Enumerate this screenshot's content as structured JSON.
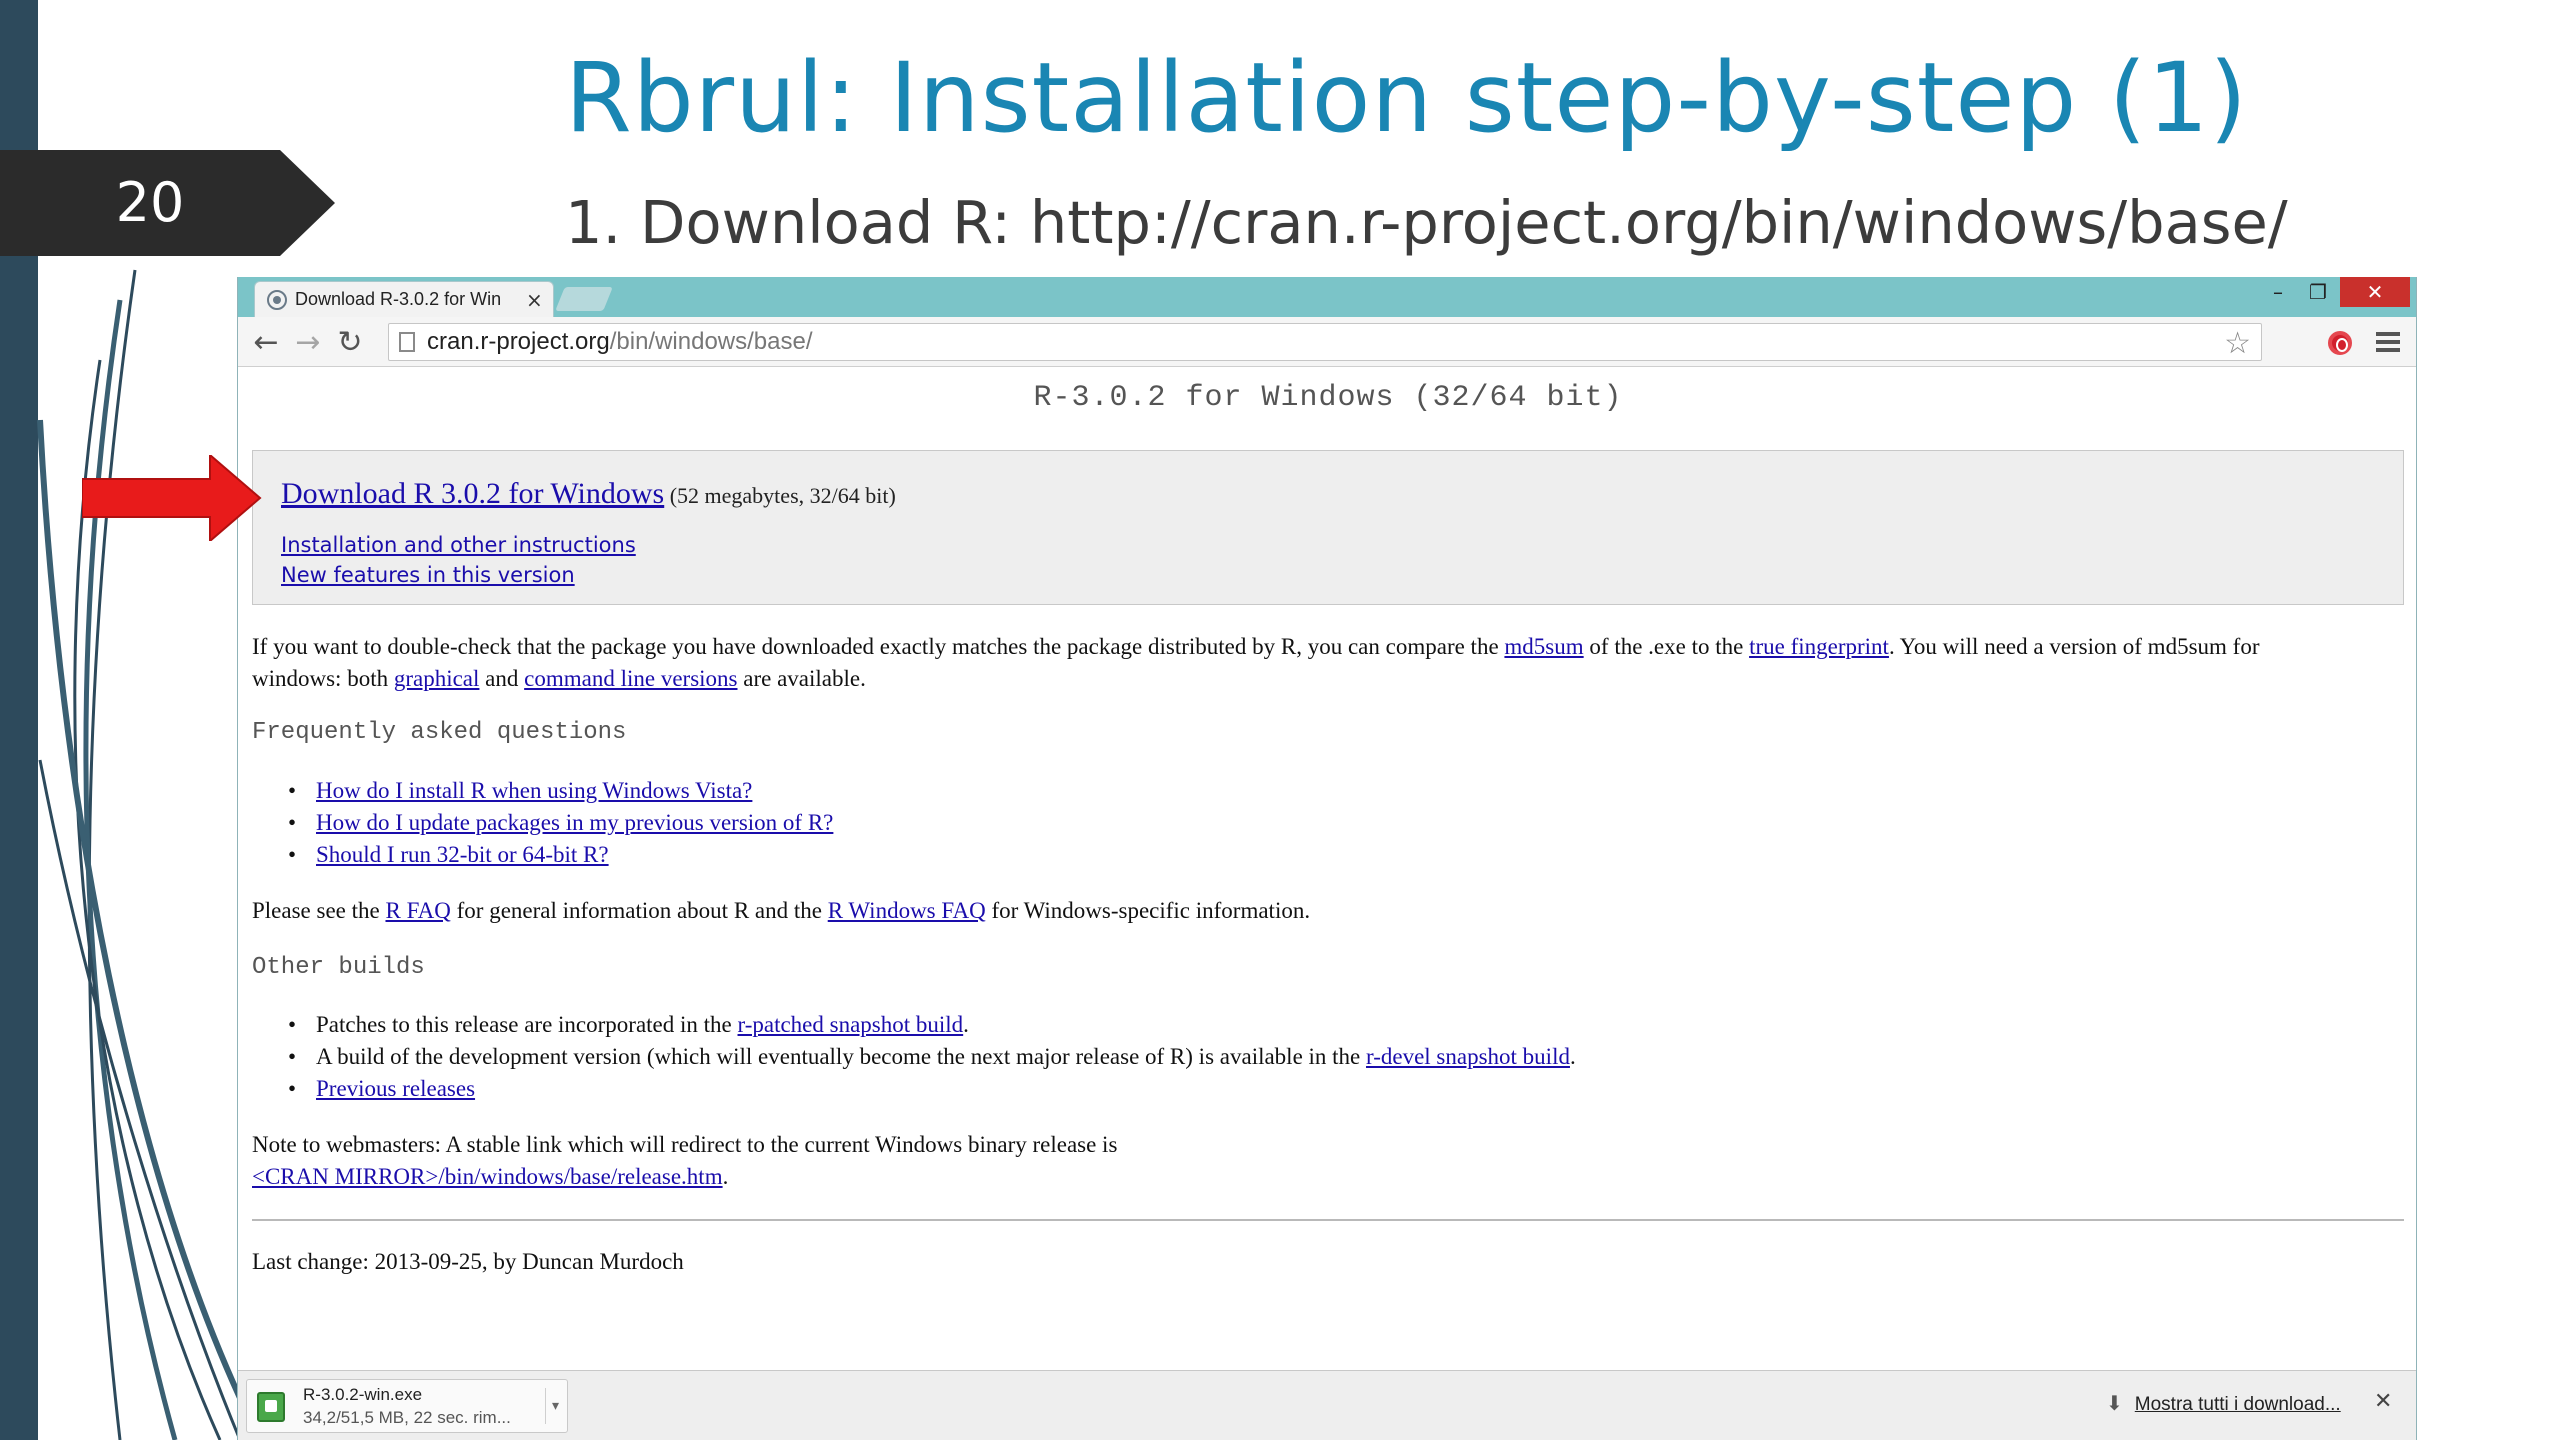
{
  "slide": {
    "number": "20",
    "title": "Rbrul: Installation step-by-step (1)",
    "subtitle": "1. Download R: http://cran.r-project.org/bin/windows/base/"
  },
  "colors": {
    "title": "#1a86b3",
    "left_bar": "#2d4a5c",
    "badge": "#2b2b2b",
    "arrow": "#e81b1b",
    "link": "#1a0dab"
  },
  "browser": {
    "tab_title": "Download R-3.0.2 for Win",
    "tab_close": "×",
    "window_controls": {
      "minimize": "–",
      "restore": "❐",
      "close": "✕"
    },
    "url_host": "cran.r-project.org",
    "url_path": "/bin/windows/base/",
    "icons": [
      "back-icon",
      "forward-icon",
      "reload-icon",
      "page-icon",
      "star-icon",
      "opera-extension-icon",
      "menu-icon"
    ]
  },
  "page": {
    "heading": "R-3.0.2 for Windows (32/64 bit)",
    "download_link": "Download R 3.0.2 for Windows",
    "download_size": " (52 megabytes, 32/64 bit)",
    "install_link": "Installation and other instructions",
    "features_link": "New features in this version",
    "para1": {
      "t1": "If you want to double-check that the package you have downloaded exactly matches the package distributed by R, you can compare the ",
      "md5sum": "md5sum",
      "t2": " of the .exe to the ",
      "fingerprint": "true fingerprint",
      "t3": ". You will need a version of md5sum for",
      "t4": "windows: both ",
      "graphical": "graphical",
      "t5": " and ",
      "cmdline": "command line versions",
      "t6": " are available."
    },
    "faq_heading": "Frequently asked questions",
    "faq": [
      "How do I install R when using Windows Vista?",
      "How do I update packages in my previous version of R?",
      "Should I run 32-bit or 64-bit R?"
    ],
    "para2": {
      "t1": "Please see the ",
      "rfaq": "R FAQ",
      "t2": " for general information about R and the ",
      "winfaq": "R Windows FAQ",
      "t3": " for Windows-specific information."
    },
    "builds_heading": "Other builds",
    "builds": {
      "b1_text": "Patches to this release are incorporated in the ",
      "b1_link": "r-patched snapshot build",
      "b1_end": ".",
      "b2_text": "A build of the development version (which will eventually become the next major release of R) is available in the ",
      "b2_link": "r-devel snapshot build",
      "b2_end": ".",
      "b3_link": "Previous releases"
    },
    "para3": {
      "t1": "Note to webmasters: A stable link which will redirect to the current Windows binary release is",
      "link": "<CRAN MIRROR>/bin/windows/base/release.htm",
      "t2": "."
    },
    "last_change": "Last change: 2013-09-25, by Duncan Murdoch"
  },
  "downloads": {
    "filename": "R-3.0.2-win.exe",
    "progress": "34,2/51,5 MB, 22 sec. rim...",
    "caret": "▾",
    "show_all": "Mostra tutti i download...",
    "close": "✕"
  }
}
